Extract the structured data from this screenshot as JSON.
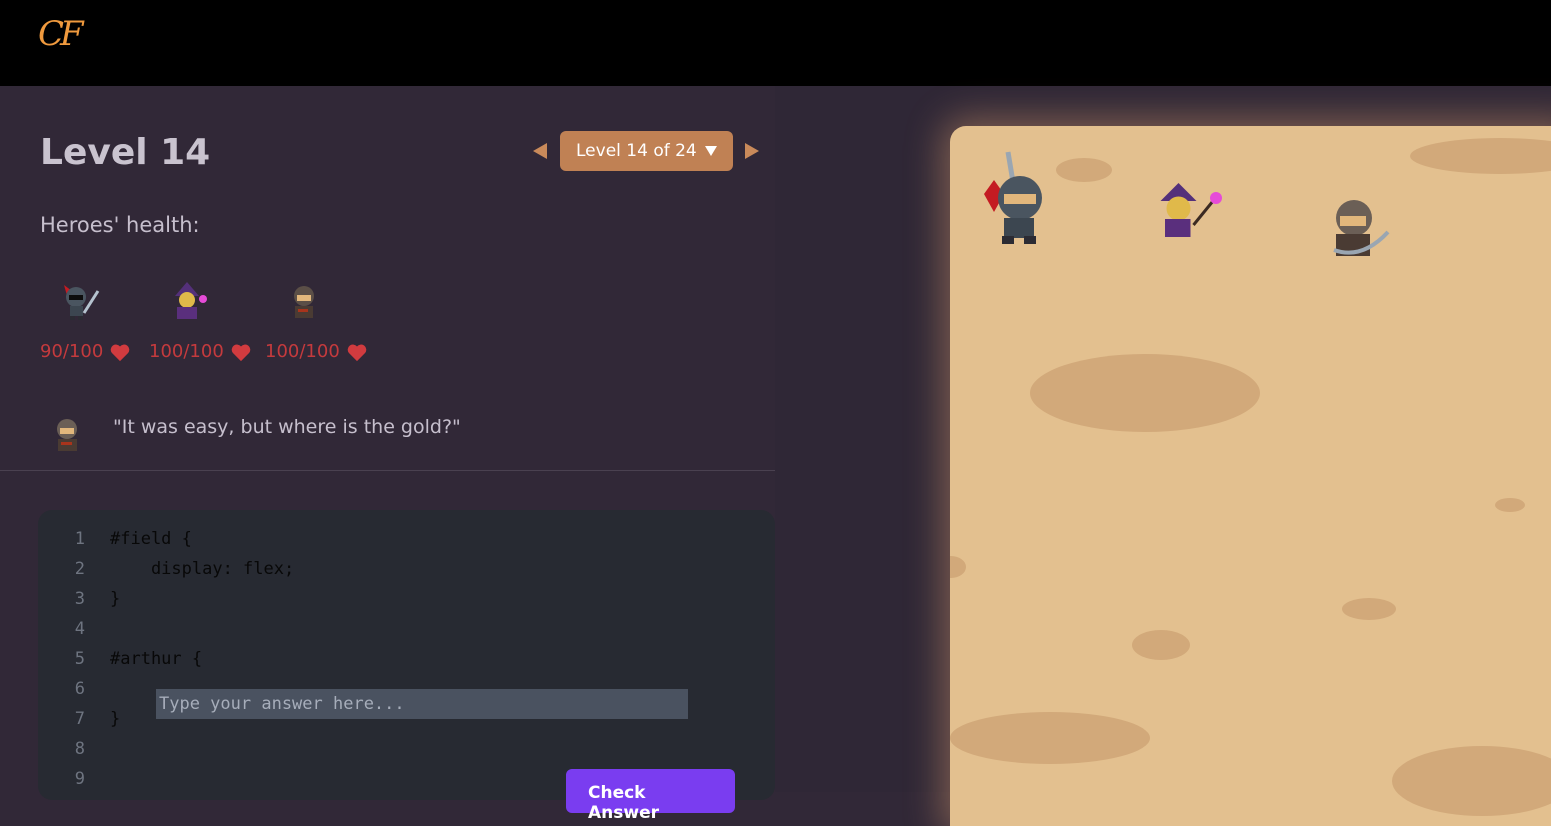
{
  "logo": "CF",
  "level": {
    "title": "Level 14",
    "selector_label": "Level 14 of 24"
  },
  "health_label": "Heroes' health:",
  "heroes": [
    {
      "name": "knight",
      "hp": "90/100"
    },
    {
      "name": "wizard",
      "hp": "100/100"
    },
    {
      "name": "rogue",
      "hp": "100/100"
    }
  ],
  "quote": "\"It was easy, but where is the gold?\"",
  "editor": {
    "lines": [
      {
        "no": "1",
        "text": "#field {"
      },
      {
        "no": "2",
        "text": "    display: flex;"
      },
      {
        "no": "3",
        "text": "}"
      },
      {
        "no": "4",
        "text": ""
      },
      {
        "no": "5",
        "text": "#arthur {"
      },
      {
        "no": "6",
        "text": ""
      },
      {
        "no": "7",
        "text": "}"
      },
      {
        "no": "8",
        "text": ""
      },
      {
        "no": "9",
        "text": ""
      }
    ],
    "answer_placeholder": "Type your answer here...",
    "check_button": "Check Answer"
  },
  "colors": {
    "accent": "#c08154",
    "hp": "#c43a3d",
    "button": "#7a3df0",
    "field": "#e3c08f"
  }
}
